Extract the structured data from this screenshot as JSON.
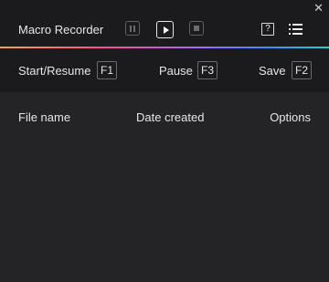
{
  "header": {
    "title": "Macro Recorder",
    "help_label": "?",
    "close_label": "✕"
  },
  "shortcuts": [
    {
      "label": "Start/Resume",
      "key": "F1"
    },
    {
      "label": "Pause",
      "key": "F3"
    },
    {
      "label": "Save",
      "key": "F2"
    }
  ],
  "table": {
    "columns": [
      "File name",
      "Date created",
      "Options"
    ],
    "rows": []
  },
  "colors": {
    "background": "#1b1b1e",
    "panel": "#242427",
    "accent_gradient": [
      "#f1a54a",
      "#ff4e8c",
      "#9c6bff",
      "#3a8dff",
      "#26d1c6"
    ]
  }
}
